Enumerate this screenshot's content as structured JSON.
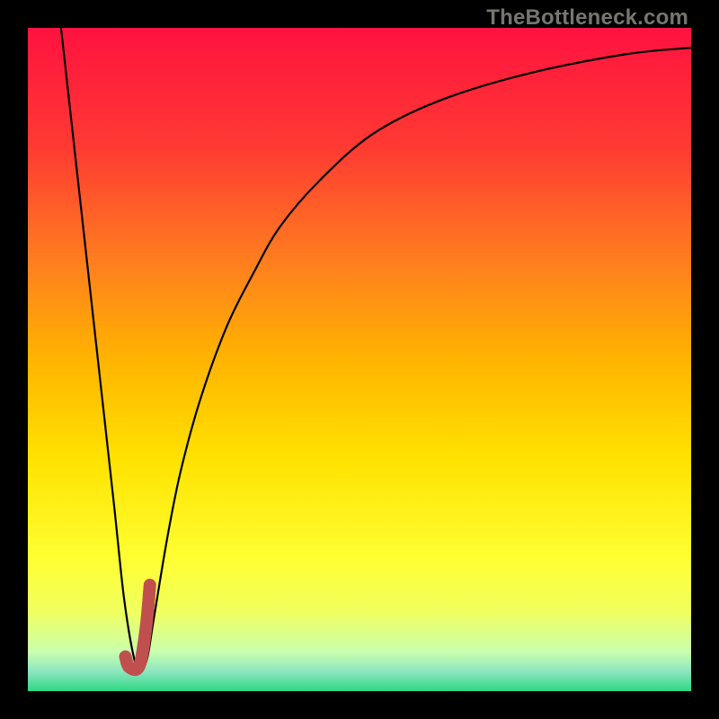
{
  "watermark": "TheBottleneck.com",
  "chart_data": {
    "type": "line",
    "title": "",
    "xlabel": "",
    "ylabel": "",
    "xlim": [
      0,
      100
    ],
    "ylim": [
      0,
      100
    ],
    "background_gradient": [
      "#ff1240",
      "#ff7d1f",
      "#ffe200",
      "#ffff32",
      "#2fd884"
    ],
    "series": [
      {
        "name": "bottleneck-curve",
        "color": "#000000",
        "stroke_width": 2.2,
        "x": [
          5,
          7,
          9,
          11,
          13,
          14.5,
          16,
          17,
          18,
          19,
          21,
          23,
          26,
          30,
          34,
          38,
          44,
          52,
          62,
          75,
          90,
          100
        ],
        "y": [
          100,
          82,
          64,
          46,
          28,
          14,
          5,
          3,
          5,
          11,
          23,
          33,
          44,
          55,
          63,
          70,
          77,
          84,
          89,
          93,
          96,
          97
        ]
      },
      {
        "name": "highlight-tick",
        "color": "#c0504d",
        "stroke_width": 14,
        "linecap": "round",
        "x": [
          14.7,
          15.3,
          16.8,
          17.8,
          18.4
        ],
        "y": [
          5.2,
          3.6,
          3.8,
          9.5,
          16.0
        ]
      }
    ]
  }
}
